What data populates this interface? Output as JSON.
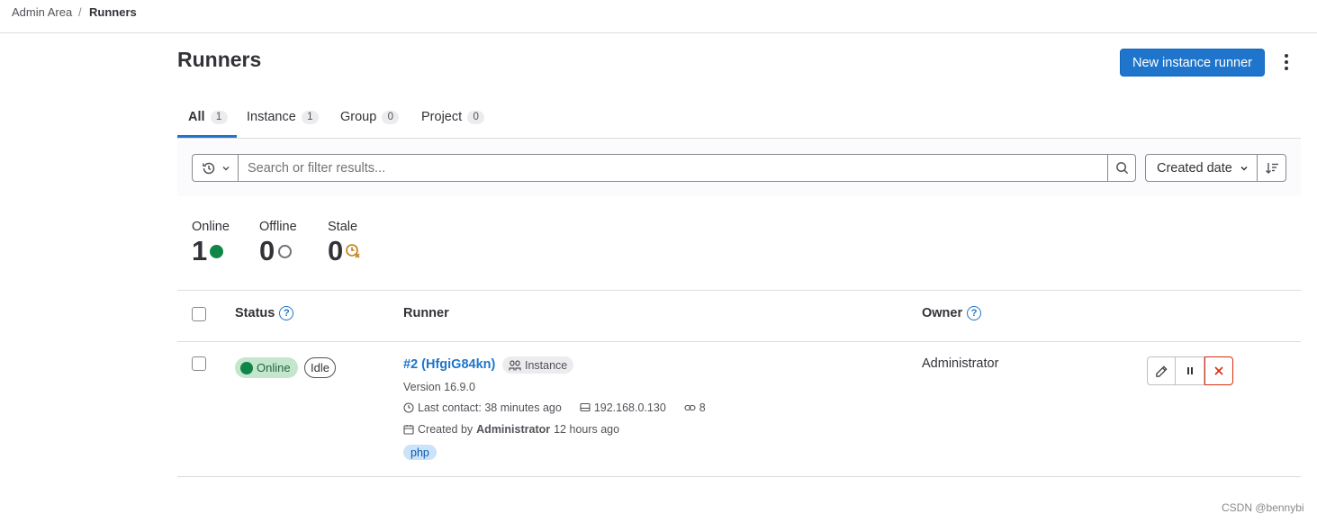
{
  "breadcrumb": {
    "parent": "Admin Area",
    "separator": "/",
    "current": "Runners"
  },
  "page": {
    "title": "Runners",
    "new_runner_label": "New instance runner"
  },
  "tabs": [
    {
      "label": "All",
      "count": "1"
    },
    {
      "label": "Instance",
      "count": "1"
    },
    {
      "label": "Group",
      "count": "0"
    },
    {
      "label": "Project",
      "count": "0"
    }
  ],
  "filter": {
    "placeholder": "Search or filter results...",
    "sort_label": "Created date"
  },
  "stats": {
    "online": {
      "label": "Online",
      "value": "1"
    },
    "offline": {
      "label": "Offline",
      "value": "0"
    },
    "stale": {
      "label": "Stale",
      "value": "0"
    }
  },
  "table": {
    "headers": {
      "status": "Status",
      "runner": "Runner",
      "owner": "Owner"
    },
    "rows": [
      {
        "status": "Online",
        "activity": "Idle",
        "runner_name": "#2 (HfgiG84kn)",
        "type_badge": "Instance",
        "version": "Version 16.9.0",
        "last_contact": "Last contact: 38 minutes ago",
        "ip": "192.168.0.130",
        "job_count": "8",
        "created_prefix": "Created by",
        "created_by": "Administrator",
        "created_when": "12 hours ago",
        "tag": "php",
        "owner": "Administrator"
      }
    ]
  },
  "colors": {
    "accent": "#1f75cb",
    "online": "#108548",
    "stale": "#c17d10",
    "danger": "#dd2b0e"
  },
  "icons": [
    "history-icon",
    "chevron-down-icon",
    "search-icon",
    "sort-icon",
    "kebab-icon",
    "help-icon",
    "clock-icon",
    "monitor-icon",
    "link-icon",
    "calendar-icon",
    "users-icon",
    "pencil-icon",
    "pause-icon",
    "close-icon",
    "stale-clock-icon"
  ],
  "watermark": "CSDN @bennybi"
}
